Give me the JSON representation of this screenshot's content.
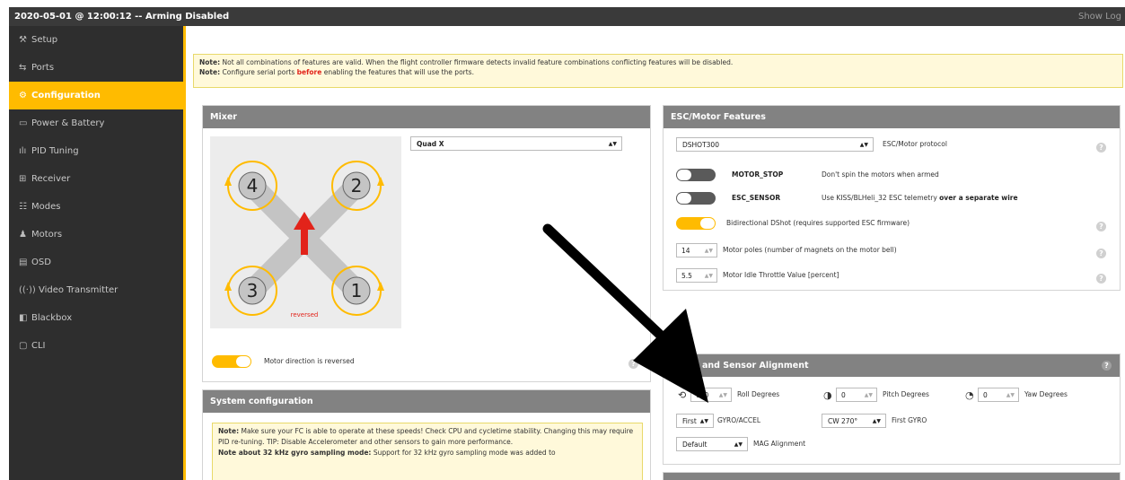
{
  "topbar": {
    "title": "2020-05-01 @ 12:00:12 -- Arming Disabled",
    "show_log": "Show Log"
  },
  "sidebar": {
    "items": [
      {
        "label": "Setup",
        "icon": "wrench-icon",
        "glyph": "⚒"
      },
      {
        "label": "Ports",
        "icon": "ports-icon",
        "glyph": "⇆"
      },
      {
        "label": "Configuration",
        "icon": "gear-icon",
        "glyph": "⚙"
      },
      {
        "label": "Power & Battery",
        "icon": "battery-icon",
        "glyph": "▭"
      },
      {
        "label": "PID Tuning",
        "icon": "tuning-icon",
        "glyph": "ılı"
      },
      {
        "label": "Receiver",
        "icon": "receiver-icon",
        "glyph": "⊞"
      },
      {
        "label": "Modes",
        "icon": "modes-icon",
        "glyph": "☷"
      },
      {
        "label": "Motors",
        "icon": "motor-icon",
        "glyph": "♟"
      },
      {
        "label": "OSD",
        "icon": "osd-icon",
        "glyph": "▤"
      },
      {
        "label": "Video Transmitter",
        "icon": "antenna-icon",
        "glyph": "((·))"
      },
      {
        "label": "Blackbox",
        "icon": "blackbox-icon",
        "glyph": "◧"
      },
      {
        "label": "CLI",
        "icon": "cli-icon",
        "glyph": "▢"
      }
    ]
  },
  "note_top": {
    "line1_bold": "Note:",
    "line1": "Not all combinations of features are valid. When the flight controller firmware detects invalid feature combinations conflicting features will be disabled.",
    "line2_bold": "Note:",
    "line2_a": "Configure serial ports",
    "line2_red": "before",
    "line2_b": "enabling the features that will use the ports."
  },
  "mixer": {
    "title": "Mixer",
    "selected": "Quad X",
    "motor_labels": [
      "4",
      "2",
      "3",
      "1"
    ],
    "reversed_label": "reversed",
    "direction_toggle_label": "Motor direction is reversed"
  },
  "esc": {
    "title": "ESC/Motor Features",
    "protocol": "DSHOT300",
    "protocol_label": "ESC/Motor protocol",
    "motor_stop_name": "MOTOR_STOP",
    "motor_stop_desc": "Don't spin the motors when armed",
    "esc_sensor_name": "ESC_SENSOR",
    "esc_sensor_desc_a": "Use KISS/BLHeli_32 ESC telemetry",
    "esc_sensor_desc_b": "over a separate wire",
    "bidir_desc": "Bidirectional DShot (requires supported ESC firmware)",
    "poles_value": "14",
    "poles_label": "Motor poles (number of magnets on the motor bell)",
    "idle_value": "5.5",
    "idle_label": "Motor Idle Throttle Value [percent]"
  },
  "board": {
    "title": "Board and Sensor Alignment",
    "roll_value": "180",
    "roll_label": "Roll Degrees",
    "pitch_value": "0",
    "pitch_label": "Pitch Degrees",
    "yaw_value": "0",
    "yaw_label": "Yaw Degrees",
    "gyro_select": "First",
    "gyro_label": "GYRO/ACCEL",
    "gyro_align": "CW 270°",
    "gyro_align_label": "First GYRO",
    "mag_align": "Default",
    "mag_label": "MAG Alignment"
  },
  "system": {
    "title": "System configuration",
    "note_bold": "Note:",
    "note_text": "Make sure your FC is able to operate at these speeds! Check CPU and cycletime stability. Changing this may require PID re-tuning. TIP: Disable Accelerometer and other sensors to gain more performance.",
    "note2_bold": "Note about 32 kHz gyro sampling mode:",
    "note2_text": "Support for 32 kHz gyro sampling mode was added to"
  }
}
